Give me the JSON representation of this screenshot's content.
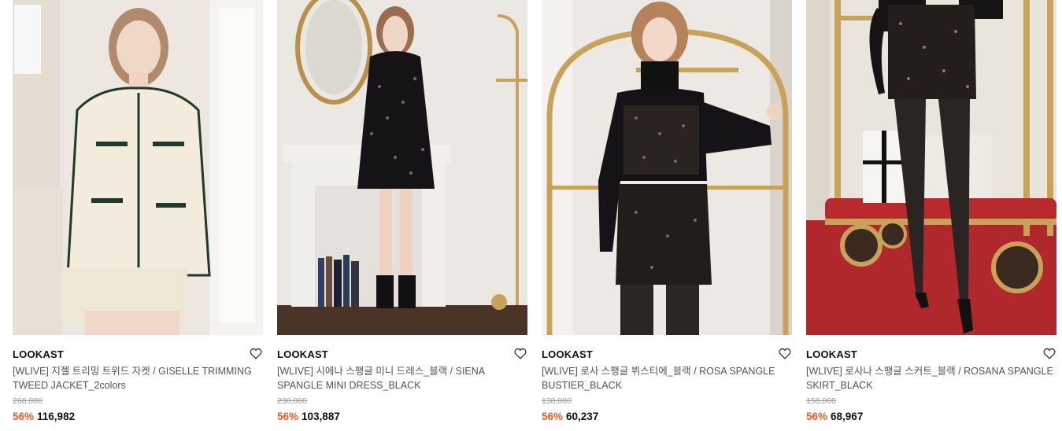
{
  "colors": {
    "discount": "#f15a22",
    "text": "#111111",
    "muted": "#555555",
    "strike": "#999999"
  },
  "icons": {
    "wishlist": "heart-outline-icon"
  },
  "products": [
    {
      "brand": "LOOKAST",
      "name": "[WLIVE] 지젤 트리밍 트위드 자켓 / GISELLE TRIMMING TWEED JACKET_2colors",
      "original_price": "268,000",
      "discount": "56%",
      "price": "116,982"
    },
    {
      "brand": "LOOKAST",
      "name": "[WLIVE] 시에나 스팽글 미니 드레스_블랙 / SIENA SPANGLE MINI DRESS_BLACK",
      "original_price": "238,000",
      "discount": "56%",
      "price": "103,887"
    },
    {
      "brand": "LOOKAST",
      "name": "[WLIVE] 로사 스팽글 뷔스티에_블랙 / ROSA SPANGLE BUSTIER_BLACK",
      "original_price": "138,000",
      "discount": "56%",
      "price": "60,237"
    },
    {
      "brand": "LOOKAST",
      "name": "[WLIVE] 로사나 스팽글 스커트_블랙 / ROSANA SPANGLE SKIRT_BLACK",
      "original_price": "158,000",
      "discount": "56%",
      "price": "68,967"
    }
  ]
}
